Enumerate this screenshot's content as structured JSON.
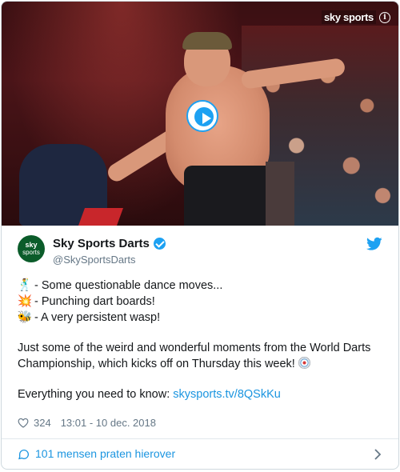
{
  "media": {
    "watermark": "sky sports",
    "info_icon": "info-icon",
    "play_icon": "play-icon"
  },
  "header": {
    "avatar_top": "sky",
    "avatar_bottom": "sports",
    "display_name": "Sky Sports Darts",
    "handle": "@SkySportsDarts",
    "verified_icon": "verified-badge-icon",
    "logo_icon": "twitter-bird-icon"
  },
  "tweet": {
    "lines": [
      {
        "emoji": "🕺",
        "text": " - Some questionable dance moves..."
      },
      {
        "emoji": "💥",
        "text": " - Punching dart boards!"
      },
      {
        "emoji": "🐝",
        "text": " - A very persistent wasp!"
      }
    ],
    "paragraph": "Just some of the weird and wonderful moments from the World Darts Championship, which kicks off on Thursday this week!",
    "cta_prefix": "Everything you need to know: ",
    "cta_link": "skysports.tv/8QSkKu"
  },
  "meta": {
    "likes": "324",
    "timestamp": "13:01 - 10 dec. 2018"
  },
  "footer": {
    "label": "101 mensen praten hierover"
  },
  "colors": {
    "link": "#1b95e0",
    "verified": "#1da1f2",
    "secondary_text": "#657786",
    "primary_text": "#14171a",
    "avatar_bg": "#0b5c2a"
  }
}
